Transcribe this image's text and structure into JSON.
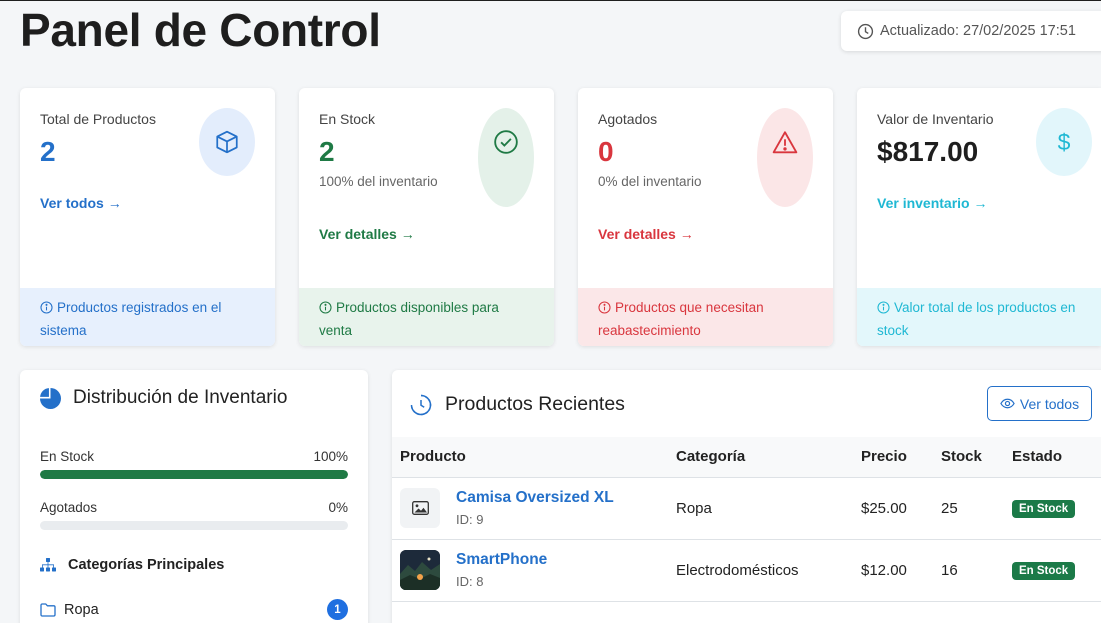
{
  "page": {
    "title": "Panel de Control",
    "updated": "Actualizado: 27/02/2025 17:51"
  },
  "colors": {
    "primary": "#2470c9",
    "success": "#1f7a45",
    "danger": "#d9363e",
    "info": "#1fb8d3"
  },
  "cards": [
    {
      "label": "Total de Productos",
      "value": "2",
      "link": "Ver todos",
      "footer": "Productos registrados en el sistema",
      "icon": "box-icon"
    },
    {
      "label": "En Stock",
      "value": "2",
      "sub": "100% del inventario",
      "link": "Ver detalles",
      "footer": "Productos disponibles para venta",
      "icon": "check-circle-icon"
    },
    {
      "label": "Agotados",
      "value": "0",
      "sub": "0% del inventario",
      "link": "Ver detalles",
      "footer": "Productos que necesitan reabastecimiento",
      "icon": "warning-icon"
    },
    {
      "label": "Valor de Inventario",
      "value": "$817.00",
      "link": "Ver inventario",
      "footer": "Valor total de los productos en stock",
      "icon": "dollar-icon"
    }
  ],
  "distribution": {
    "title": "Distribución de Inventario",
    "bars": [
      {
        "label": "En Stock",
        "percent_text": "100%",
        "value": 1.0
      },
      {
        "label": "Agotados",
        "percent_text": "0%",
        "value": 0.0
      }
    ],
    "categories_title": "Categorías Principales",
    "categories": [
      {
        "name": "Ropa",
        "count": "1"
      }
    ]
  },
  "recent": {
    "title": "Productos Recientes",
    "view_all": "Ver todos",
    "columns": [
      "Producto",
      "Categoría",
      "Precio",
      "Stock",
      "Estado"
    ],
    "rows": [
      {
        "name": "Camisa Oversized XL",
        "id": "ID: 9",
        "category": "Ropa",
        "price": "$25.00",
        "stock": "25",
        "status": "En Stock",
        "thumb": "image-placeholder-icon"
      },
      {
        "name": "SmartPhone",
        "id": "ID: 8",
        "category": "Electrodomésticos",
        "price": "$12.00",
        "stock": "16",
        "status": "En Stock",
        "thumb": "photo-thumbnail"
      }
    ]
  }
}
